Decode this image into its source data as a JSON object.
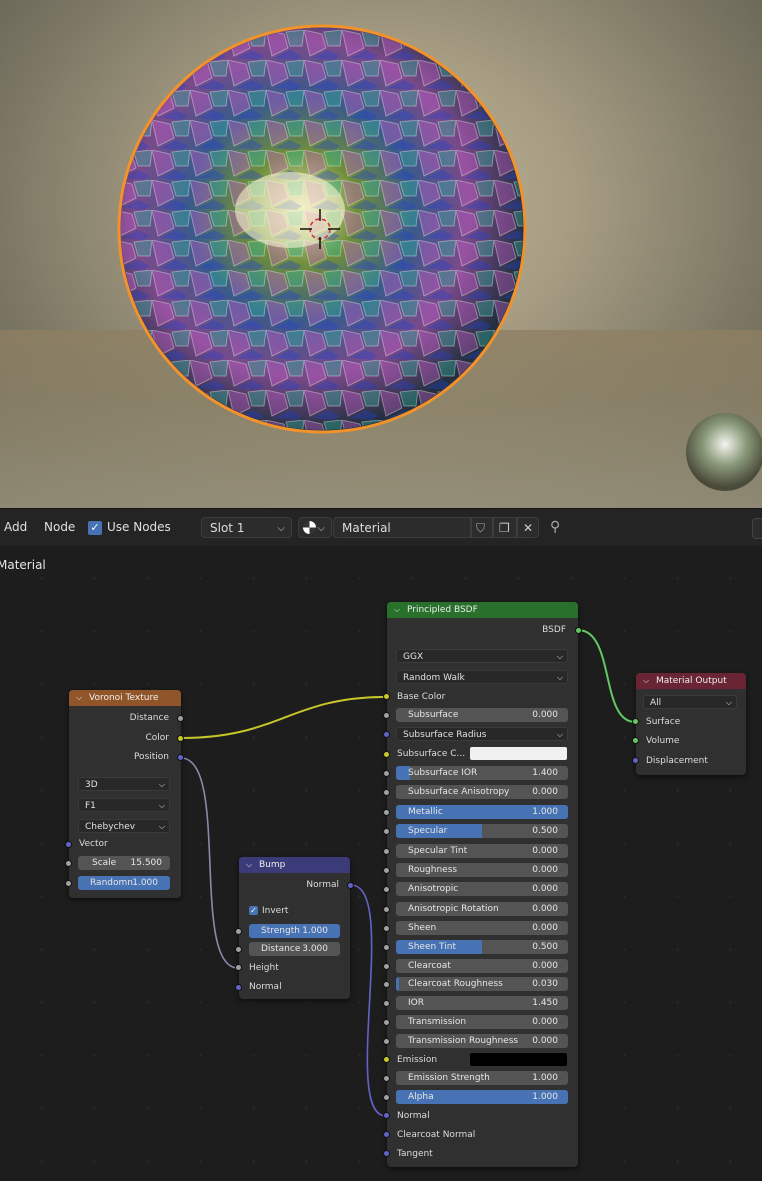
{
  "toolbar": {
    "add": "Add",
    "node": "Node",
    "use_nodes": "Use Nodes",
    "slot": "Slot 1",
    "material_name": "Material"
  },
  "editor_breadcrumb": "Material",
  "nodes": {
    "voronoi": {
      "title": "Voronoi Texture",
      "outputs": [
        "Distance",
        "Color",
        "Position"
      ],
      "dimensions": "3D",
      "feature": "F1",
      "metric": "Chebychev",
      "vector": "Vector",
      "scale_label": "Scale",
      "scale_value": "15.500",
      "randomness_label": "Randomn",
      "randomness_value": "1.000"
    },
    "bump": {
      "title": "Bump",
      "output": "Normal",
      "invert": "Invert",
      "strength_label": "Strength",
      "strength_value": "1.000",
      "distance_label": "Distance",
      "distance_value": "3.000",
      "height": "Height",
      "normal": "Normal"
    },
    "principled": {
      "title": "Principled BSDF",
      "output": "BSDF",
      "distribution": "GGX",
      "subsurface_method": "Random Walk",
      "base_color": "Base Color",
      "subsurface_radius": "Subsurface Radius",
      "subsurface_color": "Subsurface C...",
      "emission": "Emission",
      "normal": "Normal",
      "clearcoat_normal": "Clearcoat Normal",
      "tangent": "Tangent",
      "fields": [
        {
          "label": "Subsurface",
          "value": "0.000",
          "fill": 0
        },
        {
          "label": "Subsurface IOR",
          "value": "1.400",
          "fill": 0.08
        },
        {
          "label": "Subsurface Anisotropy",
          "value": "0.000",
          "fill": 0
        },
        {
          "label": "Metallic",
          "value": "1.000",
          "fill": 1
        },
        {
          "label": "Specular",
          "value": "0.500",
          "fill": 0.5
        },
        {
          "label": "Specular Tint",
          "value": "0.000",
          "fill": 0
        },
        {
          "label": "Roughness",
          "value": "0.000",
          "fill": 0
        },
        {
          "label": "Anisotropic",
          "value": "0.000",
          "fill": 0
        },
        {
          "label": "Anisotropic Rotation",
          "value": "0.000",
          "fill": 0
        },
        {
          "label": "Sheen",
          "value": "0.000",
          "fill": 0
        },
        {
          "label": "Sheen Tint",
          "value": "0.500",
          "fill": 0.5
        },
        {
          "label": "Clearcoat",
          "value": "0.000",
          "fill": 0
        },
        {
          "label": "Clearcoat Roughness",
          "value": "0.030",
          "fill": 0.03
        },
        {
          "label": "IOR",
          "value": "1.450",
          "fill": 0
        },
        {
          "label": "Transmission",
          "value": "0.000",
          "fill": 0
        },
        {
          "label": "Transmission Roughness",
          "value": "0.000",
          "fill": 0
        },
        {
          "label": "Emission Strength",
          "value": "1.000",
          "fill": 0
        },
        {
          "label": "Alpha",
          "value": "1.000",
          "fill": 1
        }
      ]
    },
    "output": {
      "title": "Material Output",
      "target": "All",
      "inputs": [
        "Surface",
        "Volume",
        "Displacement"
      ]
    }
  },
  "colors": {
    "voronoi_header": "#91552a",
    "bump_header": "#3b3b7a",
    "principled_header": "#28702b",
    "output_header": "#692533",
    "selection_outline": "#f2922a",
    "field_fill": "#4772b3"
  }
}
